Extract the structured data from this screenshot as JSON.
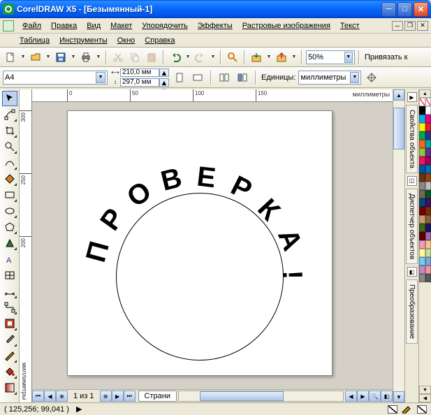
{
  "title": "CorelDRAW X5 - [Безымянный-1]",
  "menu1": [
    "Файл",
    "Правка",
    "Вид",
    "Макет",
    "Упорядочить",
    "Эффекты",
    "Растровые изображения",
    "Текст"
  ],
  "menu2": [
    "Таблица",
    "Инструменты",
    "Окно",
    "Справка"
  ],
  "zoom": "50%",
  "snap_label": "Привязать к",
  "paper": "A4",
  "width": "210,0 мм",
  "height": "297,0 мм",
  "units_label": "Единицы:",
  "units_value": "миллиметры",
  "ruler_unit": "миллиметры",
  "rulerV_unit": "миллиметры",
  "rulerH_ticks": [
    "0",
    "50",
    "100",
    "150"
  ],
  "rulerV_ticks": [
    "300",
    "250",
    "200"
  ],
  "page_info": "1 из 1",
  "page_tab": "Страни",
  "coords": "( 125,256; 99,041 )",
  "canvas_text": "ПРОВЕРКА!",
  "dockers": [
    "Свойства объекта",
    "Диспетчер объектов",
    "Преобразование"
  ],
  "palette_colors": [
    "#000000",
    "#ffffff",
    "#00aeef",
    "#ec008c",
    "#fff200",
    "#ed1c24",
    "#00a651",
    "#2e3192",
    "#f26522",
    "#00a99d",
    "#8dc63f",
    "#662d91",
    "#ed145b",
    "#9e005d",
    "#0054a6",
    "#0072bc",
    "#603913",
    "#a0410d",
    "#898989",
    "#c0c0c0",
    "#726658",
    "#005826",
    "#004a80",
    "#440e62",
    "#790000",
    "#7b2e00",
    "#c69c6d",
    "#8b5e3c",
    "#406618",
    "#1b1464",
    "#5b0000",
    "#a864a8",
    "#f49ac1",
    "#fdc689",
    "#fff799",
    "#c4df9b",
    "#6dcff6",
    "#7da7d9",
    "#bd8cbf",
    "#f5989d",
    "#898989",
    "#58595b"
  ],
  "chart_data": null
}
